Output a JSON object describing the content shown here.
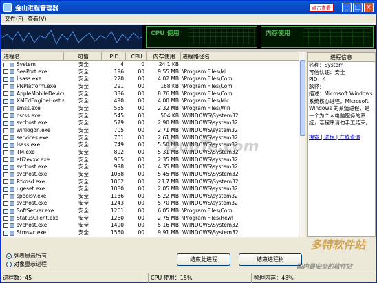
{
  "window": {
    "title": "金山进程管理器",
    "badge": "点击查看"
  },
  "menu": [
    "文件(F)",
    "查看(V)"
  ],
  "monitor": {
    "cpu_label": "CPU 使用",
    "mem_label": "内存使用"
  },
  "columns": [
    "进程名",
    "可信",
    "PID",
    "CPU",
    "内存使用",
    "进程路径名"
  ],
  "rows": [
    [
      "System",
      "安全",
      "4",
      "0",
      "24.1 KB",
      ""
    ],
    [
      "SeaPort.exe",
      "安全",
      "196",
      "00",
      "9.55 MB",
      "\\Program Files\\Mi"
    ],
    [
      "Lsass.exe",
      "安全",
      "220",
      "00",
      "4.02 MB",
      "\\Program Files\\Com"
    ],
    [
      "PNPlatform.exe",
      "安全",
      "291",
      "00",
      "168 KB",
      "\\Program Files\\Com"
    ],
    [
      "AppleMobileDeviceService.exe",
      "安全",
      "336",
      "00",
      "8.76 MB",
      "\\Program Files\\Com"
    ],
    [
      "XMEdEngineHost.exe",
      "安全",
      "490",
      "00",
      "4.00 MB",
      "\\Program Files\\Mic"
    ],
    [
      "smss.exe",
      "安全",
      "555",
      "00",
      "2.32 MB",
      "\\Program Files\\Win"
    ],
    [
      "csrss.exe",
      "安全",
      "545",
      "00",
      "504 KB",
      "\\WINDOWS\\System32"
    ],
    [
      "svchost.exe",
      "安全",
      "579",
      "00",
      "2.90 MB",
      "\\WINDOWS\\system32"
    ],
    [
      "winlogon.exe",
      "安全",
      "705",
      "00",
      "2.71 MB",
      "\\WINDOWS\\system32"
    ],
    [
      "services.exe",
      "安全",
      "701",
      "00",
      "2.61 MB",
      "\\WINDOWS\\system32"
    ],
    [
      "lsass.exe",
      "安全",
      "749",
      "00",
      "5.50 MB",
      "\\WINDOWS\\system32"
    ],
    [
      "TM.exe",
      "安全",
      "892",
      "00",
      "5.31 MB",
      "\\WINDOWS\\System32"
    ],
    [
      "ati2evxx.exe",
      "安全",
      "965",
      "00",
      "2.35 MB",
      "\\WINDOWS\\system32"
    ],
    [
      "svchost.exe",
      "安全",
      "998",
      "00",
      "4.35 MB",
      "\\WINDOWS\\system32"
    ],
    [
      "svchost.exe",
      "安全",
      "1058",
      "00",
      "5.45 MB",
      "\\WINDOWS\\System32"
    ],
    [
      "Rtkosd.exe",
      "安全",
      "1062",
      "00",
      "23.7 MB",
      "\\WINDOWS\\System32"
    ],
    [
      "ugeset.exe",
      "安全",
      "1080",
      "00",
      "2.05 MB",
      "\\WINDOWS\\system32"
    ],
    [
      "spoolsv.exe",
      "安全",
      "1136",
      "00",
      "5.22 MB",
      "\\WINDOWS\\system32"
    ],
    [
      "svchost.exe",
      "安全",
      "1243",
      "00",
      "5.70 MB",
      "\\WINDOWS\\system32"
    ],
    [
      "SoftServer.exe",
      "安全",
      "1261",
      "00",
      "6.05 MB",
      "\\Program Files\\Com"
    ],
    [
      "StatusClient.exe",
      "安全",
      "1260",
      "00",
      "2.75 MB",
      "\\Program Files\\Hewl"
    ],
    [
      "svchost.exe",
      "安全",
      "1490",
      "00",
      "5.16 MB",
      "\\WINDOWS\\System32"
    ],
    [
      "Stmsvc.exe",
      "安全",
      "1550",
      "00",
      "9.91 MB",
      "\\WINDOWS\\System32"
    ]
  ],
  "detail": {
    "header": "进程信息",
    "name": "名称：System",
    "trust": "可信认证：安全",
    "pid": "PID：4",
    "path": "路径：",
    "desc": "描述：Microsoft Windows系统核心进程。Microsoft Windows 的系统进程，是一个为个人电脑服务的系统，若程序请勿手工结束。",
    "links": "搜索 | 进程 | 在线查询"
  },
  "options": {
    "show_all": "列表显示所有",
    "show_trusted": "对象显示进程"
  },
  "buttons": {
    "end_process": "结束此进程",
    "end_tree": "结束进程树"
  },
  "status": {
    "count": "进程数：45",
    "cpu": "CPU 使用：15%",
    "mem": "物理内存：48%"
  },
  "watermarks": [
    "DuoTe.com",
    "多特软件站",
    "国内最安全的软件站"
  ]
}
